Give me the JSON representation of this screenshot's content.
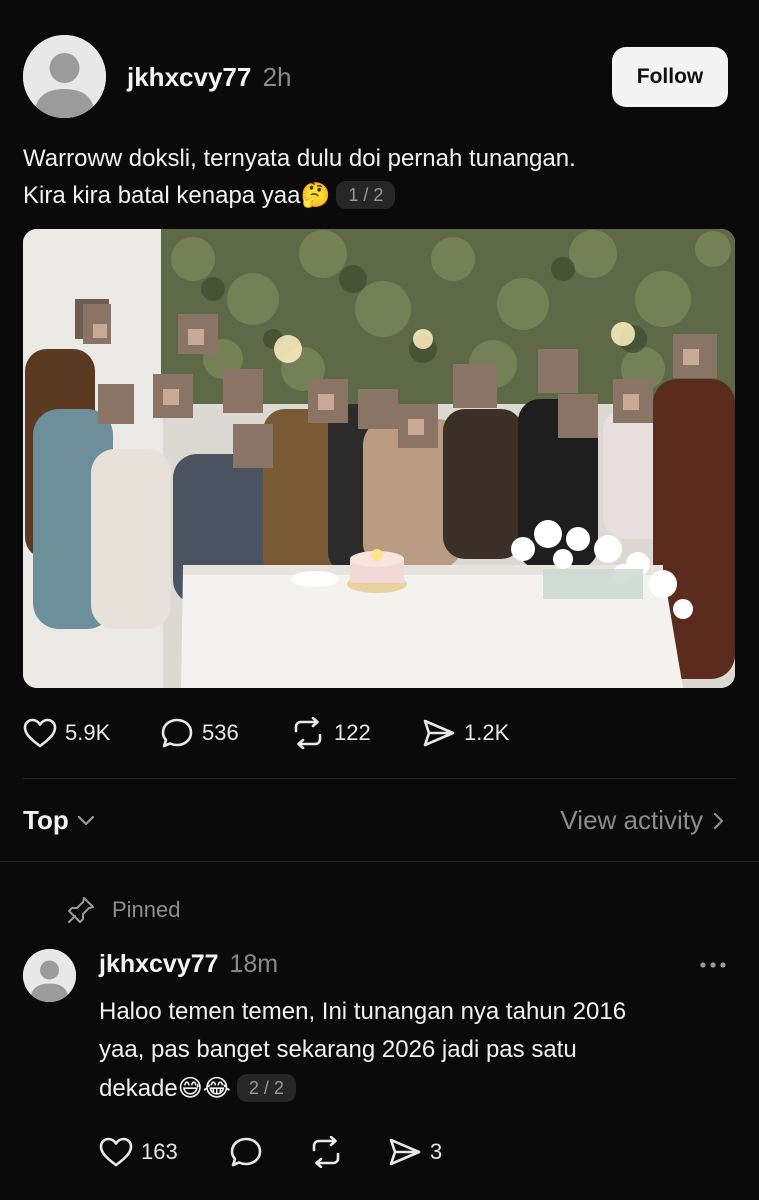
{
  "post": {
    "username": "jkhxcvy77",
    "time": "2h",
    "follow_label": "Follow",
    "text_line1": "Warroww doksli, ternyata dulu doi pernah tunangan.",
    "text_line2": "Kira kira batal kenapa yaa",
    "emoji": "🤔",
    "pager": "1 / 2",
    "image_icon": "group-photo-blurred-faces",
    "stats": {
      "likes": "5.9K",
      "comments": "536",
      "reposts": "122",
      "shares": "1.2K"
    }
  },
  "sort": {
    "label": "Top",
    "view_activity": "View activity"
  },
  "reply": {
    "pinned_label": "Pinned",
    "username": "jkhxcvy77",
    "time": "18m",
    "text_line1": "Haloo temen temen, Ini tunangan nya tahun 2016",
    "text_line2": "yaa, pas banget sekarang 2026 jadi pas satu",
    "text_line3": "dekade",
    "emoji": "😅😂",
    "pager": "2 / 2",
    "stats": {
      "likes": "163",
      "shares": "3"
    }
  }
}
